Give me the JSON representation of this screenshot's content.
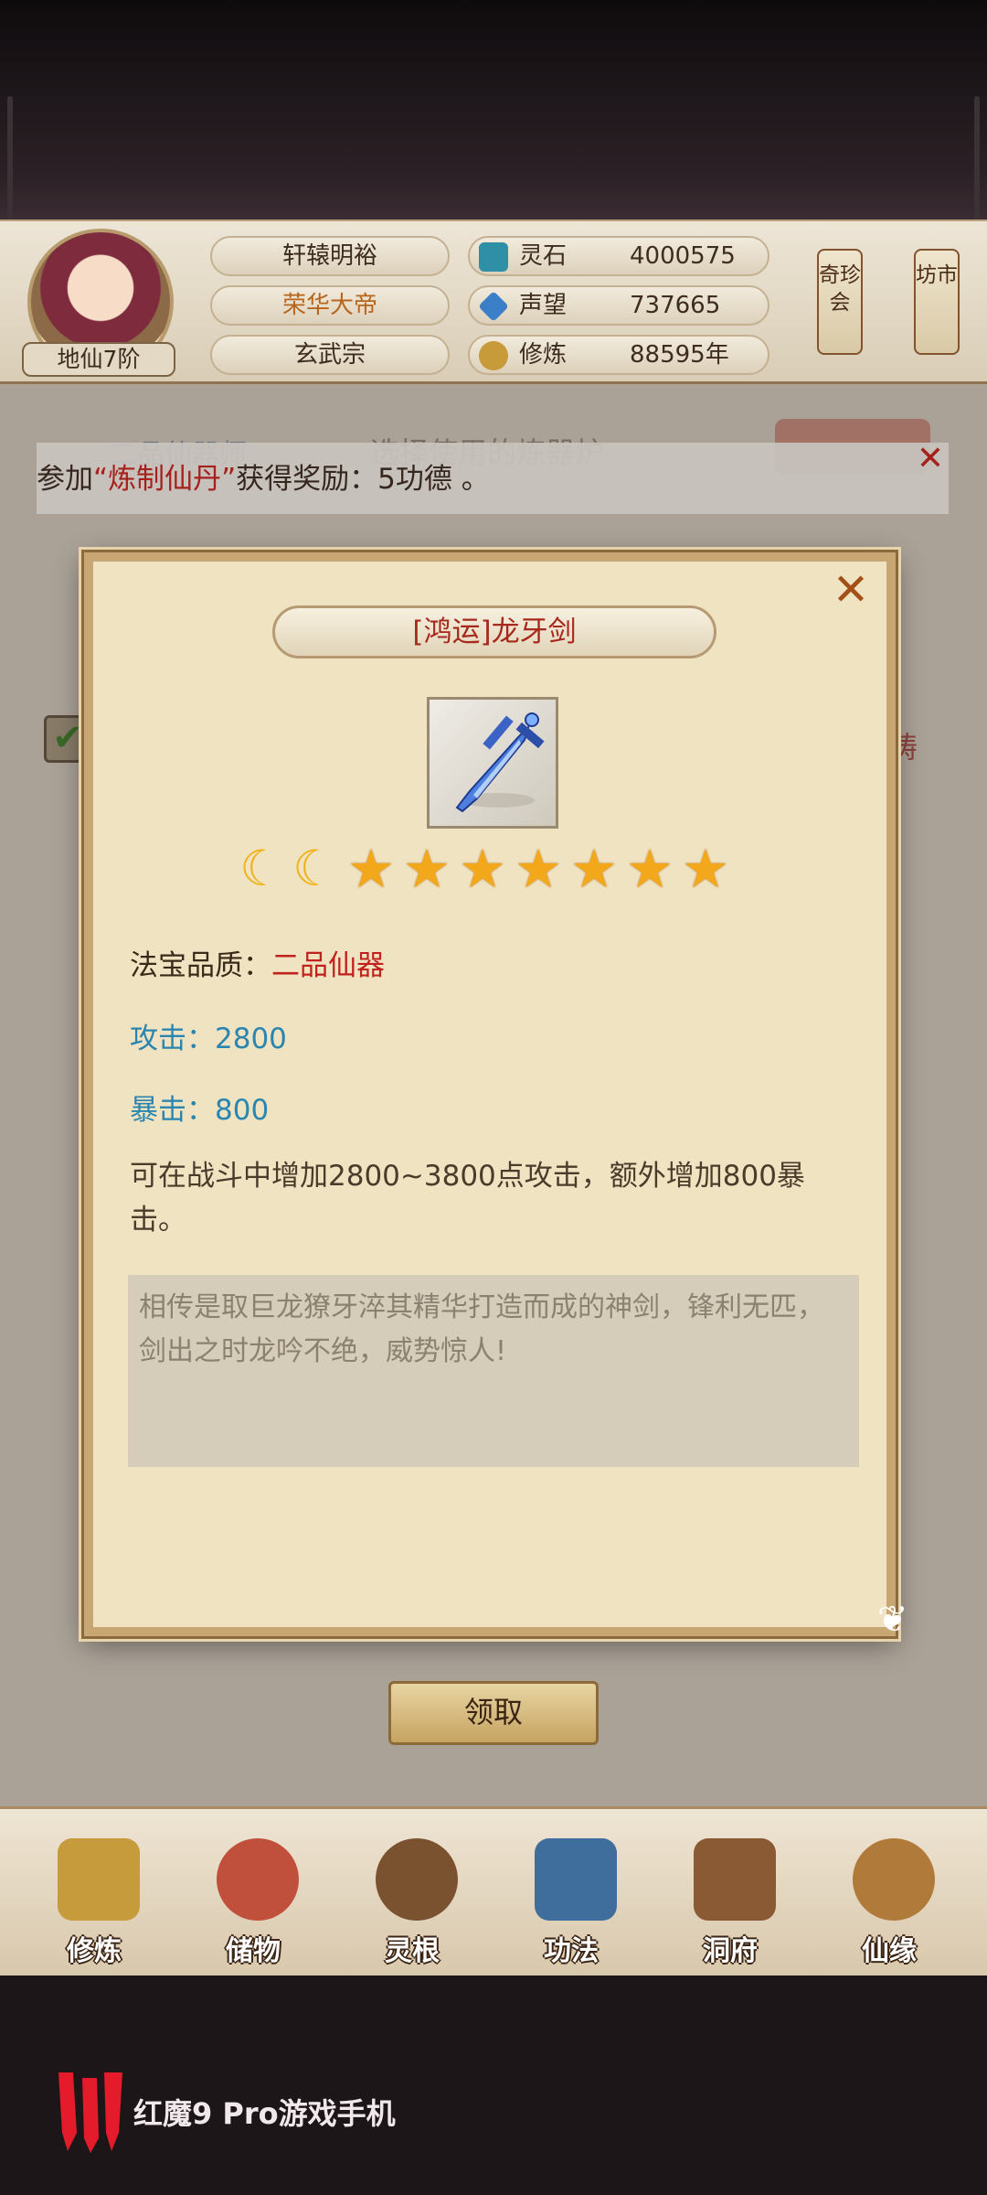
{
  "header": {
    "realm": "地仙7阶",
    "names": [
      "轩辕明裕",
      "荣华大帝",
      "玄武宗"
    ],
    "title_color": "#b8651c",
    "resources": [
      {
        "icon": "spirit-stone-icon",
        "label": "灵石",
        "value": "4000575"
      },
      {
        "icon": "prestige-crystal-icon",
        "label": "声望",
        "value": "737665"
      },
      {
        "icon": "meditation-icon",
        "label": "修炼",
        "value": "88595年"
      }
    ],
    "side_tabs": [
      "奇珍会",
      "坊市"
    ]
  },
  "background": {
    "rank_text": "二品仙器师",
    "furnace_text": "选择使用的炼器炉",
    "red_text": "铸"
  },
  "notice": {
    "prefix": "参加",
    "quote_open": "“",
    "highlight": "炼制仙丹",
    "quote_close": "”",
    "suffix": "获得奖励：5功德 。",
    "close_icon": "close-icon"
  },
  "item": {
    "name": "[鸿运]龙牙剑",
    "icon": "dragon-fang-sword-icon",
    "moons": 2,
    "stars": 7,
    "quality_label": "法宝品质：",
    "quality_value": "二品仙器",
    "attack": "攻击：2800",
    "crit": "暴击：800",
    "effect": "可在战斗中增加2800~3800点攻击，额外增加800暴击。",
    "lore": "相传是取巨龙獠牙淬其精华打造而成的神剑，锋利无匹，剑出之时龙吟不绝，威势惊人!",
    "close_symbol": "✕"
  },
  "claim_button": "领取",
  "bottom_nav": [
    {
      "label": "修炼",
      "icon": "cultivate-icon",
      "color": "#c59b3c"
    },
    {
      "label": "储物",
      "icon": "storage-bag-icon",
      "color": "#c0503b"
    },
    {
      "label": "灵根",
      "icon": "spirit-root-icon",
      "color": "#7a5230"
    },
    {
      "label": "功法",
      "icon": "technique-book-icon",
      "color": "#3f6d9c"
    },
    {
      "label": "洞府",
      "icon": "cave-dwelling-icon",
      "color": "#8a5a34"
    },
    {
      "label": "仙缘",
      "icon": "immortal-fate-icon",
      "color": "#b07a3a"
    }
  ],
  "brand": {
    "text": "红魔9 Pro游戏手机",
    "logo": "red-magic-logo-icon"
  }
}
